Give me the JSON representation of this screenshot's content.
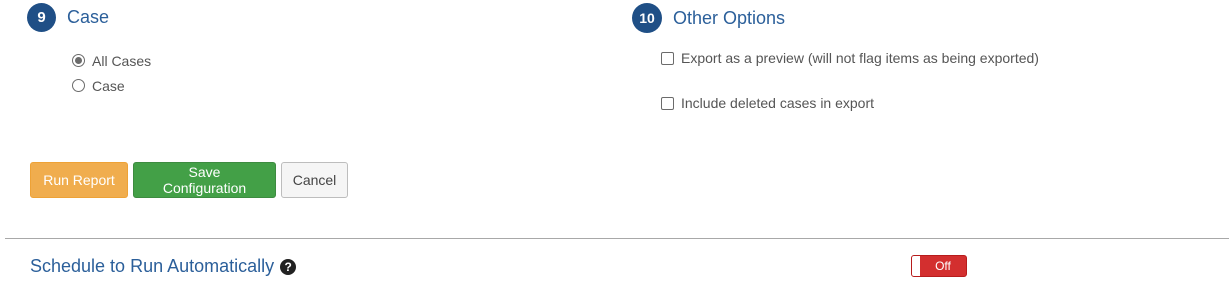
{
  "case_section": {
    "step": "9",
    "title": "Case",
    "options": [
      {
        "label": "All Cases",
        "selected": true
      },
      {
        "label": "Case",
        "selected": false
      }
    ]
  },
  "other_options": {
    "step": "10",
    "title": "Other Options",
    "checkboxes": [
      {
        "label": "Export as a preview (will not flag items as being exported)",
        "checked": false
      },
      {
        "label": "Include deleted cases in export",
        "checked": false
      }
    ]
  },
  "buttons": {
    "run": "Run Report",
    "save": "Save Configuration",
    "cancel": "Cancel"
  },
  "schedule": {
    "title": "Schedule to Run Automatically",
    "help_icon": "question-circle-icon",
    "toggle_label": "Off",
    "toggle_state": false
  },
  "colors": {
    "badge": "#1f4f86",
    "heading": "#2b5f9a",
    "run_button": "#f0ad4e",
    "save_button": "#43a047",
    "toggle_off": "#d32f2f"
  }
}
